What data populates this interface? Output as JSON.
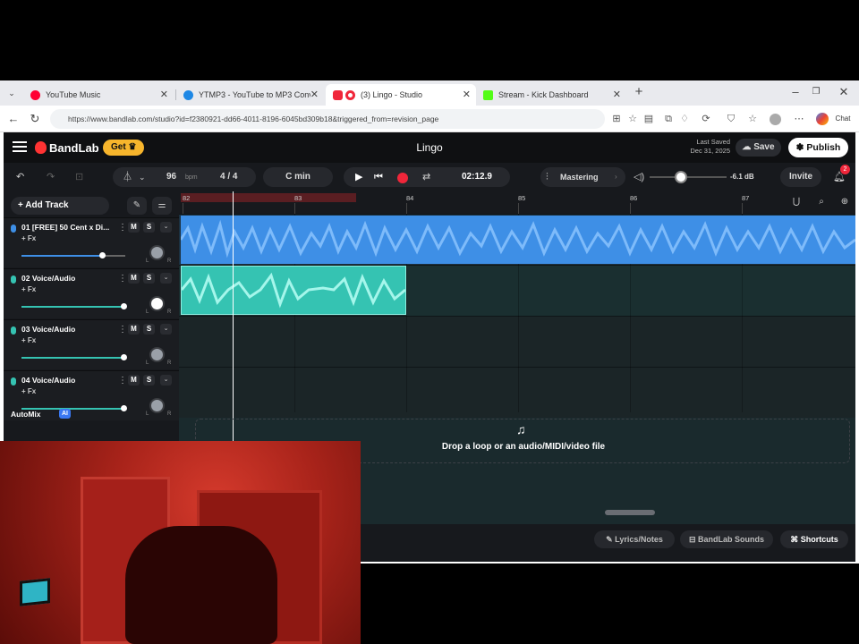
{
  "browser": {
    "tabs": [
      {
        "label": "YouTube Music",
        "color": "#ff0033"
      },
      {
        "label": "YTMP3 - YouTube to MP3 Conver",
        "color": "#1e88e5"
      },
      {
        "label": "(3) Lingo - Studio",
        "color": "#f0263a"
      },
      {
        "label": "Stream - Kick Dashboard",
        "color": "#53fc18"
      }
    ],
    "url": "https://www.bandlab.com/studio?id=f2380921-dd66-4011-8196-6045bd309b18&triggered_from=revision_page",
    "chat_label": "Chat"
  },
  "app": {
    "brand": "BandLab",
    "get_label": "Get",
    "song_title": "Lingo",
    "last_saved_label": "Last Saved",
    "last_saved_date": "Dec 31, 2025",
    "save_label": "Save",
    "publish_label": "Publish",
    "invite_label": "Invite",
    "notification_count": "2"
  },
  "transport": {
    "bpm": "96",
    "bpm_unit": "bpm",
    "time_signature": "4 / 4",
    "key": "C min",
    "time": "02:12.9",
    "mastering_label": "Mastering",
    "volume_db": "-6.1 dB"
  },
  "tracks": {
    "add_track_label": "Add Track",
    "fx_label": "+ Fx",
    "items": [
      {
        "name": "01 [FREE] 50 Cent x Di...",
        "mute": "M",
        "solo": "S",
        "volume": 0.78,
        "color": "#3e8fe6"
      },
      {
        "name": "02 Voice/Audio",
        "mute": "M",
        "solo": "S",
        "volume": 0.98,
        "color": "#35c3b2"
      },
      {
        "name": "03 Voice/Audio",
        "mute": "M",
        "solo": "S",
        "volume": 0.98,
        "color": "#35c3b2"
      },
      {
        "name": "04 Voice/Audio",
        "mute": "M",
        "solo": "S",
        "volume": 0.98,
        "color": "#35c3b2"
      }
    ],
    "automix_label": "AutoMix",
    "ai_label": "AI"
  },
  "timeline": {
    "bars": [
      "82",
      "83",
      "84",
      "85",
      "86",
      "87"
    ],
    "drop_text": "Drop a loop or an audio/MIDI/video file"
  },
  "bottom": {
    "lyrics_label": "Lyrics/Notes",
    "sounds_label": "BandLab Sounds",
    "shortcuts_label": "Shortcuts"
  }
}
